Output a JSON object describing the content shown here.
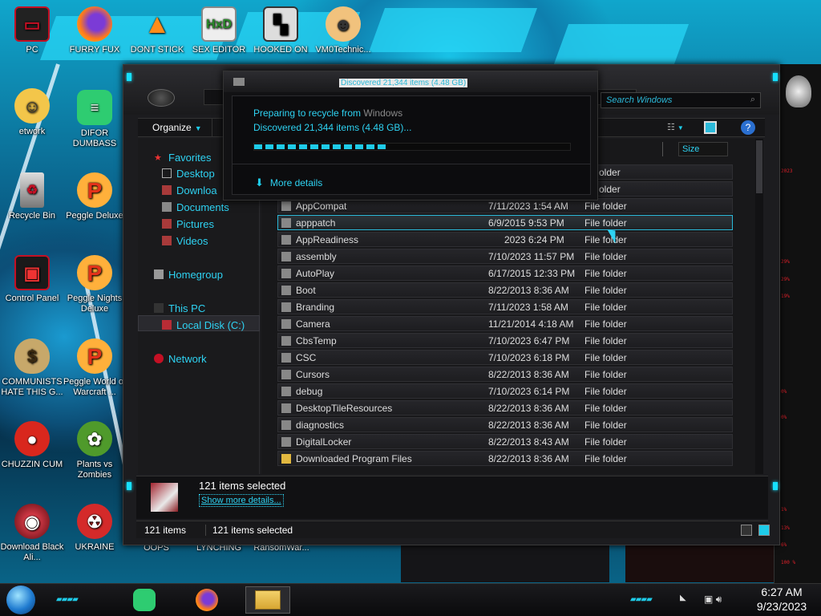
{
  "desktop": {
    "icons_col1": [
      {
        "label": "PC",
        "icon": "computer-icon"
      },
      {
        "label": "etwork",
        "icon": "network-icon"
      },
      {
        "label": "Recycle Bin",
        "icon": "recycle-bin-icon"
      },
      {
        "label": "Control Panel",
        "icon": "control-panel-icon"
      },
      {
        "label": "COMMUNISTS HATE THIS G...",
        "icon": "money-bag-icon"
      },
      {
        "label": "CHUZZIN CUM",
        "icon": "chuzzle-icon"
      },
      {
        "label": "Download Black Ali...",
        "icon": "alienware-icon"
      }
    ],
    "icons_col2": [
      {
        "label": "FURRY FUX",
        "icon": "firefox-icon"
      },
      {
        "label": "DIFOR DUMBASS",
        "icon": "discord-icon"
      },
      {
        "label": "Peggle Deluxe",
        "icon": "peggle-icon"
      },
      {
        "label": "Peggle Nights Deluxe",
        "icon": "peggle-icon"
      },
      {
        "label": "Peggle World of Warcraft ...",
        "icon": "peggle-icon"
      },
      {
        "label": "Plants vs Zombies",
        "icon": "pvz-icon"
      },
      {
        "label": "UKRAINE",
        "icon": "radiation-icon"
      }
    ],
    "icons_top": [
      {
        "label": "DONT STICK",
        "icon": "vlc-icon"
      },
      {
        "label": "SEX EDITOR",
        "icon": "hxd-icon"
      },
      {
        "label": "HOOKED ON",
        "icon": "game-icon"
      },
      {
        "label": "VM0Technic...",
        "icon": "doctor-icon"
      }
    ],
    "icons_bottom": [
      {
        "label": "OOPS"
      },
      {
        "label": "LYNCHING"
      },
      {
        "label": "RansomWar..."
      }
    ]
  },
  "explorer": {
    "search_placeholder": "Search Windows",
    "toolbar": {
      "organize_label": "Organize"
    },
    "nav": {
      "favorites": "Favorites",
      "desktop": "Desktop",
      "downloads": "Downloa",
      "documents": "Documents",
      "pictures": "Pictures",
      "videos": "Videos",
      "homegroup": "Homegroup",
      "this_pc": "This PC",
      "local_disk": "Local Disk (C:)",
      "network": "Network"
    },
    "columns": {
      "size": "Size"
    },
    "files": [
      {
        "name": "",
        "date": "",
        "type": "older"
      },
      {
        "name": "",
        "date": "",
        "type": "older"
      },
      {
        "name": "AppCompat",
        "date": "7/11/2023 1:54 AM",
        "type": "File folder"
      },
      {
        "name": "apppatch",
        "date": "6/9/2015 9:53 PM",
        "type": "File folder"
      },
      {
        "name": "AppReadiness",
        "date": "2023 6:24 PM",
        "type": "File folder"
      },
      {
        "name": "assembly",
        "date": "7/10/2023 11:57 PM",
        "type": "File folder"
      },
      {
        "name": "AutoPlay",
        "date": "6/17/2015 12:33 PM",
        "type": "File folder"
      },
      {
        "name": "Boot",
        "date": "8/22/2013 8:36 AM",
        "type": "File folder"
      },
      {
        "name": "Branding",
        "date": "7/11/2023 1:58 AM",
        "type": "File folder"
      },
      {
        "name": "Camera",
        "date": "11/21/2014 4:18 AM",
        "type": "File folder"
      },
      {
        "name": "CbsTemp",
        "date": "7/10/2023 6:47 PM",
        "type": "File folder"
      },
      {
        "name": "CSC",
        "date": "7/10/2023 6:18 PM",
        "type": "File folder"
      },
      {
        "name": "Cursors",
        "date": "8/22/2013 8:36 AM",
        "type": "File folder"
      },
      {
        "name": "debug",
        "date": "7/10/2023 6:14 PM",
        "type": "File folder"
      },
      {
        "name": "DesktopTileResources",
        "date": "8/22/2013 8:36 AM",
        "type": "File folder"
      },
      {
        "name": "diagnostics",
        "date": "8/22/2013 8:36 AM",
        "type": "File folder"
      },
      {
        "name": "DigitalLocker",
        "date": "8/22/2013 8:43 AM",
        "type": "File folder"
      },
      {
        "name": "Downloaded Program Files",
        "date": "8/22/2013 8:36 AM",
        "type": "File folder"
      }
    ],
    "details": {
      "title": "121 items selected",
      "link": "Show more details..."
    },
    "status": {
      "count": "121 items",
      "selected": "121 items selected"
    }
  },
  "progress": {
    "title": "Discovered 21,344 items (4.48 GB)",
    "preparing": "Preparing to recycle from",
    "source": "Windows",
    "discovered": "Discovered 21,344 items (4.48 GB)...",
    "more_details": "More details",
    "fraction": 0.42
  },
  "taskbar": {
    "time": "6:27 AM",
    "date": "9/23/2023"
  },
  "right_panel": {
    "readouts": [
      "2023",
      "29%",
      "29%",
      "19%",
      "0%",
      "0%",
      "1%",
      "13%",
      "6%",
      "100 %"
    ]
  },
  "colors": {
    "accent": "#2ed2f2",
    "brand_red": "#c41024"
  }
}
